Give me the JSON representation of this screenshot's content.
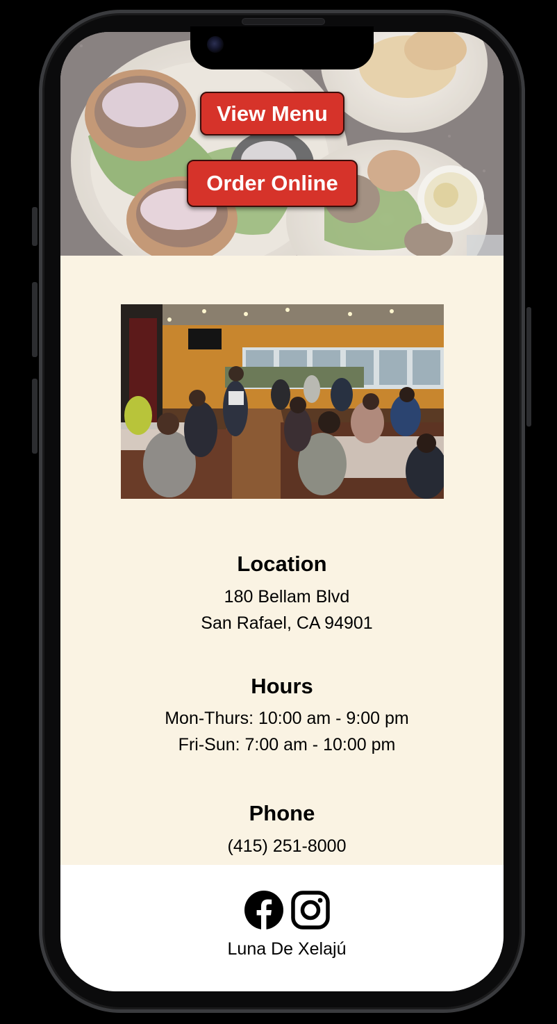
{
  "hero": {
    "view_menu_label": "View Menu",
    "order_online_label": "Order Online"
  },
  "info": {
    "location": {
      "heading": "Location",
      "line1": "180 Bellam Blvd",
      "line2": "San Rafael, CA 94901"
    },
    "hours": {
      "heading": "Hours",
      "line1": "Mon-Thurs: 10:00 am - 9:00 pm",
      "line2": "Fri-Sun: 7:00 am - 10:00 pm"
    },
    "phone": {
      "heading": "Phone",
      "number": "(415) 251-8000"
    }
  },
  "footer": {
    "icons": [
      "facebook-icon",
      "instagram-icon"
    ],
    "brand_name": "Luna De Xelajú"
  },
  "colors": {
    "button_red": "#d6332a",
    "info_background": "#faf3e3",
    "footer_background": "#ffffff"
  }
}
